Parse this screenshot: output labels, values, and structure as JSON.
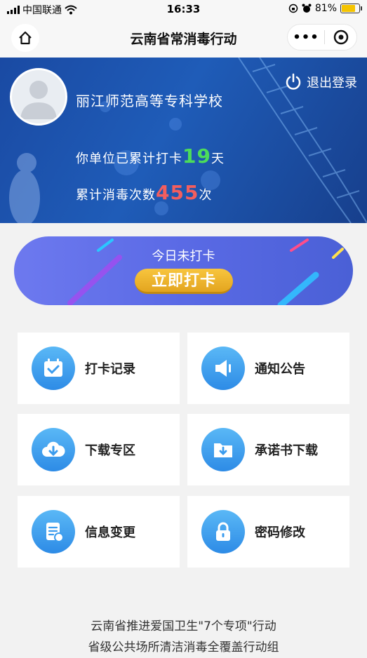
{
  "status_bar": {
    "carrier": "中国联通",
    "time": "16:33",
    "battery": "81%"
  },
  "nav": {
    "title": "云南省常消毒行动"
  },
  "banner": {
    "school": "丽江师范高等专科学校",
    "logout_label": "退出登录",
    "stat1_prefix": "你单位已累计打卡",
    "stat1_value": "19",
    "stat1_suffix": "天",
    "stat2_prefix": "累计消毒次数",
    "stat2_value": "455",
    "stat2_suffix": "次"
  },
  "checkin": {
    "status": "今日未打卡",
    "button": "立即打卡"
  },
  "menu": [
    {
      "label": "打卡记录",
      "icon": "calendar-check-icon"
    },
    {
      "label": "通知公告",
      "icon": "speaker-icon"
    },
    {
      "label": "下载专区",
      "icon": "cloud-download-icon"
    },
    {
      "label": "承诺书下载",
      "icon": "folder-download-icon"
    },
    {
      "label": "信息变更",
      "icon": "document-edit-icon"
    },
    {
      "label": "密码修改",
      "icon": "lock-icon"
    }
  ],
  "footer": {
    "line1": "云南省推进爱国卫生\"7个专项\"行动",
    "line2": "省级公共场所清洁消毒全覆盖行动组"
  }
}
